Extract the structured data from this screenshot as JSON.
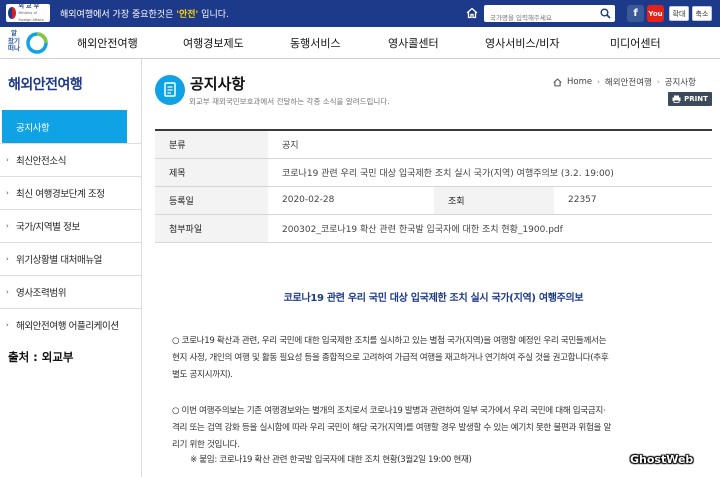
{
  "topbar": {
    "logo_text": "외 교 부",
    "logo_sub": "Ministry of Foreign Affairs",
    "notice_before": "해외여행에서 가장 중요한것은 ",
    "notice_highlight": "'안전'",
    "notice_after": " 입니다.",
    "search_placeholder": "국가명을 입력해주세요",
    "zoom_in": "확대",
    "zoom_out": "축소",
    "youtube": "You"
  },
  "nav": {
    "logo_text": "알\n찼기\n떠나",
    "items": [
      "해외안전여행",
      "여행경보제도",
      "동행서비스",
      "영사콜센터",
      "영사서비스/비자",
      "미디어센터"
    ]
  },
  "sidebar": {
    "title": "해외안전여행",
    "items": [
      "공지사항",
      "최신안전소식",
      "최신 여행경보단계 조정",
      "국가/지역별 정보",
      "위기상황별 대처매뉴얼",
      "영사조력범위",
      "해외안전여행 어플리케이션"
    ],
    "source": "출처 : 외교부"
  },
  "page": {
    "title": "공지사항",
    "description": "외교부 재외국민보호과에서 전달하는 각종 소식을 알려드립니다.",
    "breadcrumb": [
      "Home",
      "해외안전여행",
      "공지사항"
    ],
    "print_label": "PRINT"
  },
  "info": {
    "category_label": "분류",
    "category_value": "공지",
    "subject_label": "제목",
    "subject_value": "코로나19 관련 우리 국민 대상 입국제한 조치 실시 국가(지역) 여행주의보 (3.2. 19:00)",
    "date_label": "등록일",
    "date_value": "2020-02-28",
    "views_label": "조회",
    "views_value": "22357",
    "attachment_label": "첨부파일",
    "attachment_value": "200302_코로나19 확산 관련 한국발 입국자에 대한 조치 현황_1900.pdf"
  },
  "article": {
    "title": "코로나19 관련 우리 국민 대상 입국제한 조치 실시 국가(지역) 여행주의보",
    "p1_line1": "○ 코로나19 확산과 관련, 우리 국민에 대한 입국제한 조치를 실시하고 있는 별첨 국가(지역)을 여행할 예정인 우리 국민들께서는",
    "p1_line2": "현지 사정, 개인의 여행 및 활동 필요성 등을 종합적으로 고려하여 가급적 여행을 재고하거나 연기하여 주실 것을 권고합니다(추후",
    "p1_line3": "별도 공지시까지).",
    "p2_line1": "○ 이번 여행주의보는 기존 여행경보와는 별개의 조치로서 코로나19 발병과 관련하여 일부 국가에서 우리 국민에 대해 입국금지·",
    "p2_line2": "격리 또는 검역 강화 등을 실시함에 따라 우리 국민이 해당 국가(지역)를 여행할 경우 발생할 수 있는 예기치 못한 불편과 위험을 알",
    "p2_line3": "리기 위한 것입니다.",
    "note": "※ 붙임: 코로나19 확산 관련 한국발 입국자에 대한 조치 현황(3월2일 19:00 현재)"
  },
  "watermark": "GhostWeb",
  "colors": {
    "topbar": "#1d3a8a",
    "accent": "#0fa3e5",
    "highlight": "#ffd400"
  }
}
